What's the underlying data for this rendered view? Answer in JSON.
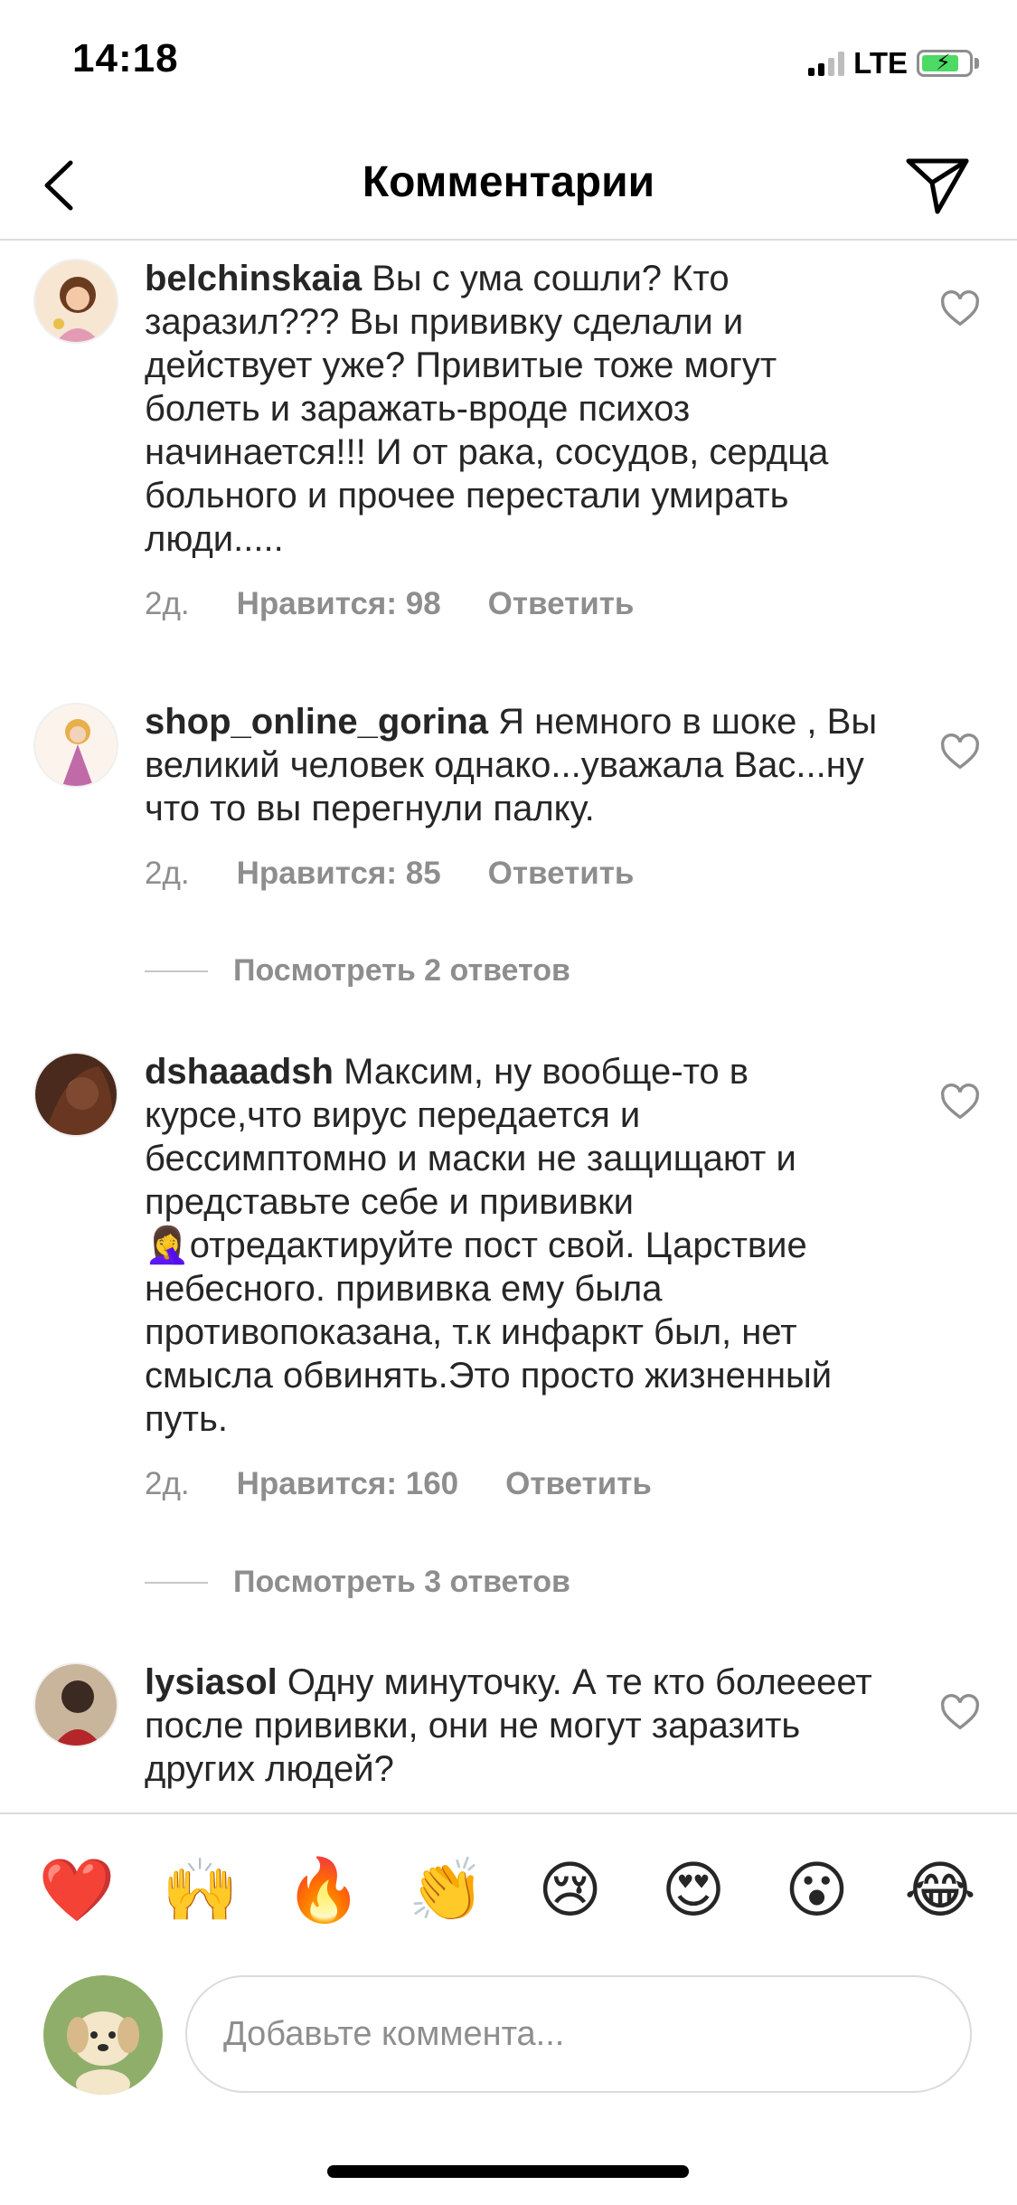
{
  "status_bar": {
    "time": "14:18",
    "network": "LTE"
  },
  "header": {
    "title": "Комментарии"
  },
  "comments": [
    {
      "username": "belchinskaia",
      "text": "Вы с ума сошли? Кто заразил??? Вы прививку сделали и действует уже? Привитые тоже могут болеть и заражать-вроде психоз начинается!!! И от рака, сосудов, сердца больного и прочее перестали умирать люди.....",
      "time": "2д.",
      "likes": "Нравится: 98",
      "reply": "Ответить"
    },
    {
      "username": "shop_online_gorina",
      "text": "Я немного в шоке , Вы великий человек однако...уважала Вас...ну что то вы перегнули палку.",
      "time": "2д.",
      "likes": "Нравится: 85",
      "reply": "Ответить",
      "view_replies": "Посмотреть 2 ответов"
    },
    {
      "username": "dshaaadsh",
      "text": "Максим, ну вообще-то в курсе,что вирус передается и бессимптомно и маски не защищают и представьте себе и прививки 🤦‍♀️отредактируйте пост свой. Царствие небесного. прививка ему была противопоказана, т.к инфаркт был, нет смысла обвинять.Это просто жизненный путь.",
      "time": "2д.",
      "likes": "Нравится: 160",
      "reply": "Ответить",
      "view_replies": "Посмотреть 3 ответов"
    },
    {
      "username": "lysiasol",
      "text": "Одну минуточку. А те кто болеееет после прививки, они не могут заразить других людей?"
    }
  ],
  "reactions": [
    "❤️",
    "🙌",
    "🔥",
    "👏",
    "😢",
    "😍",
    "😮",
    "😂"
  ],
  "composer": {
    "placeholder": "Добавьте коммента..."
  },
  "colors": {
    "text": "#262626",
    "muted": "#8e8e8e",
    "divider": "#dbdbdb",
    "battery": "#4cd964"
  }
}
